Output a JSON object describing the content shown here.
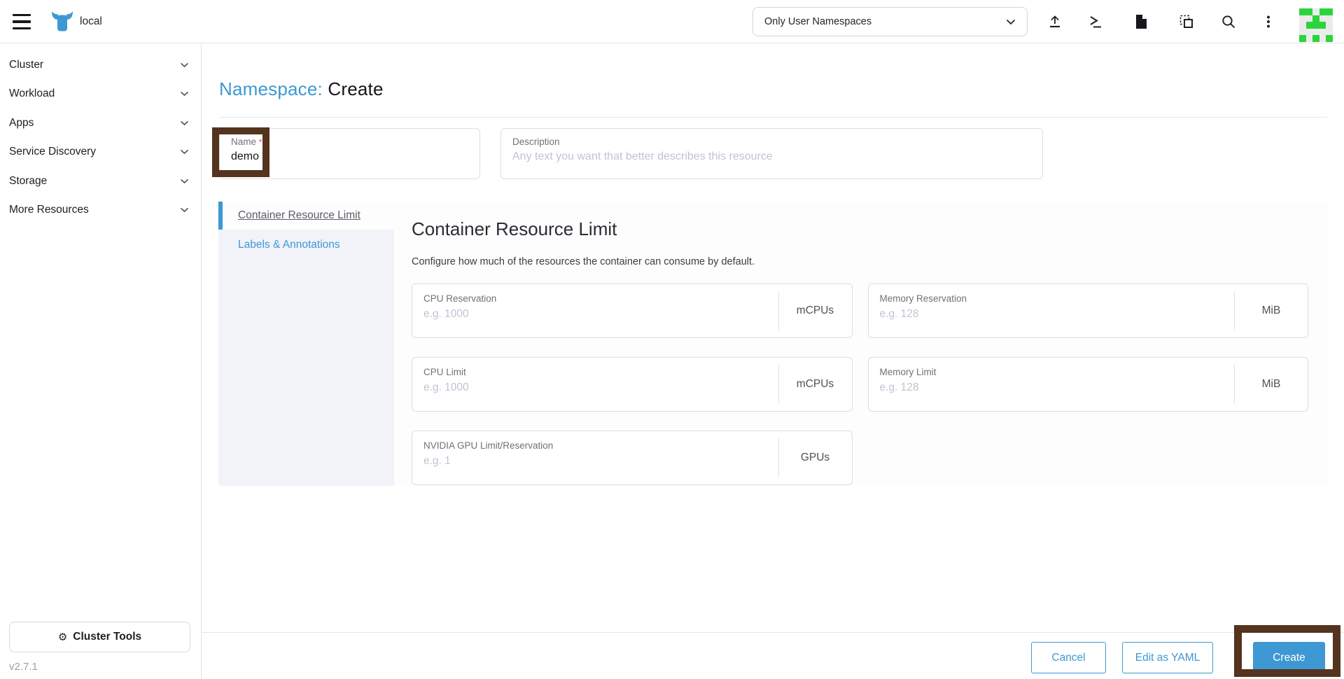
{
  "colors": {
    "primary": "#3d98d3",
    "annotation_highlight": "#54331f",
    "avatar_green": "#2cd43c"
  },
  "header": {
    "cluster_name": "local",
    "namespace_filter": {
      "selected": "Only User Namespaces"
    }
  },
  "sidebar": {
    "items": [
      {
        "label": "Cluster"
      },
      {
        "label": "Workload"
      },
      {
        "label": "Apps"
      },
      {
        "label": "Service Discovery"
      },
      {
        "label": "Storage"
      },
      {
        "label": "More Resources"
      }
    ],
    "cluster_tools_label": "Cluster Tools",
    "version": "v2.7.1"
  },
  "page": {
    "title_prefix": "Namespace:",
    "title_action": "Create",
    "name_field": {
      "label": "Name",
      "required_marker": "*",
      "value": "demo"
    },
    "description_field": {
      "label": "Description",
      "placeholder": "Any text you want that better describes this resource"
    }
  },
  "tabs": {
    "items": [
      {
        "label": "Container Resource Limit",
        "active": true
      },
      {
        "label": "Labels & Annotations",
        "active": false
      }
    ]
  },
  "section": {
    "heading": "Container Resource Limit",
    "subheading": "Configure how much of the resources the container can consume by default.",
    "fields": [
      {
        "label": "CPU Reservation",
        "placeholder": "e.g. 1000",
        "unit": "mCPUs"
      },
      {
        "label": "Memory Reservation",
        "placeholder": "e.g. 128",
        "unit": "MiB"
      },
      {
        "label": "CPU Limit",
        "placeholder": "e.g. 1000",
        "unit": "mCPUs"
      },
      {
        "label": "Memory Limit",
        "placeholder": "e.g. 128",
        "unit": "MiB"
      },
      {
        "label": "NVIDIA GPU Limit/Reservation",
        "placeholder": "e.g. 1",
        "unit": "GPUs"
      }
    ]
  },
  "footer": {
    "cancel_label": "Cancel",
    "edit_yaml_label": "Edit as YAML",
    "create_label": "Create"
  },
  "avatar": {
    "pattern": [
      "11011",
      "00100",
      "01110",
      "00000",
      "10101"
    ]
  }
}
